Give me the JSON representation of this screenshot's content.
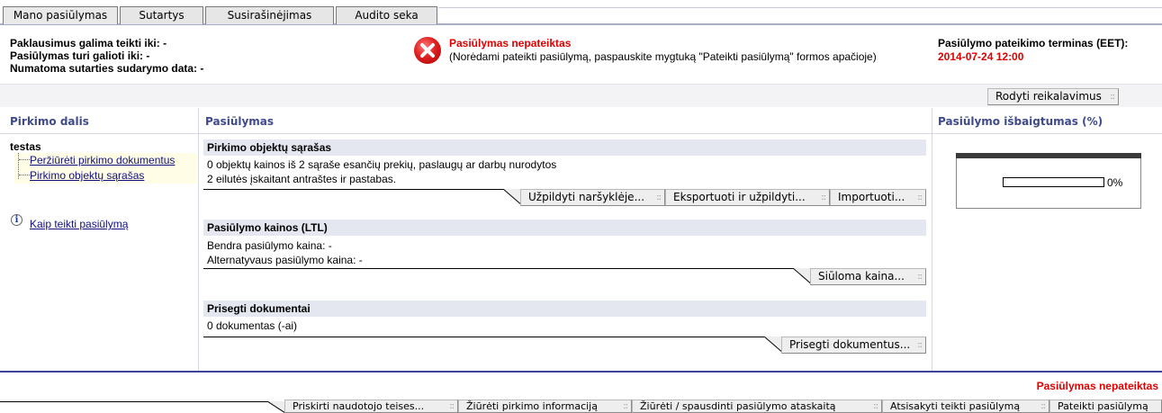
{
  "tabs": [
    "Mano pasiūlymas",
    "Sutartys",
    "Susirašinėjimas",
    "Audito seka"
  ],
  "header": {
    "left_lines": [
      "Paklausimus galima teikti iki: -",
      "Pasiūlymas turi galioti iki: -",
      "Numatoma sutarties sudarymo data: -"
    ],
    "status_title": "Pasiūlymas nepateiktas",
    "status_note": "(Norėdami pateikti pasiūlymą, paspauskite mygtuką \"Pateikti pasiūlymą\" formos apačioje)",
    "deadline_label": "Pasiūlymo pateikimo terminas (EET):",
    "deadline_value": "2014-07-24 12:00"
  },
  "show_requirements_button": "Rodyti reikalavimus",
  "columns": {
    "left": "Pirkimo dalis",
    "middle": "Pasiūlymas",
    "right": "Pasiūlymo išbaigtumas (%)"
  },
  "tree": {
    "root": "testas",
    "items": [
      "Peržiūrėti pirkimo dokumentus",
      "Pirkimo objektų sąrašas"
    ]
  },
  "help_link": "Kaip teikti pasiūlymą",
  "sections": {
    "objects": {
      "title": "Pirkimo objektų sąrašas",
      "line1": "0 objektų kainos iš 2 sąraše esančių prekių, paslaugų ar darbų nurodytos",
      "line2": "2 eilutės įskaitant antraštes ir pastabas.",
      "buttons": [
        "Užpildyti naršyklėje...",
        "Eksportuoti ir užpildyti...",
        "Importuoti..."
      ]
    },
    "prices": {
      "title": "Pasiūlymo kainos  (LTL)",
      "line1": "Bendra pasiūlymo kaina: -",
      "line2": "Alternatyvaus pasiūlymo kaina: -",
      "buttons": [
        "Siūloma kaina..."
      ]
    },
    "docs": {
      "title": "Prisegti dokumentai",
      "line1": "0  dokumentas (-ai)",
      "buttons": [
        "Prisegti dokumentus..."
      ]
    }
  },
  "completeness": {
    "percent": 0,
    "label": "0%"
  },
  "footer": {
    "status": "Pasiūlymas nepateiktas",
    "buttons": [
      "Priskirti naudotojo teises...",
      "Žiūrėti pirkimo informaciją",
      "Žiūrėti / spausdinti pasiūlymo ataskaitą",
      "Atsisakyti teikti pasiūlymą",
      "Pateikti pasiūlymą"
    ]
  },
  "colors": {
    "accent": "#3a4599",
    "error": "#e00000",
    "section_bg": "#e4e6f0"
  }
}
